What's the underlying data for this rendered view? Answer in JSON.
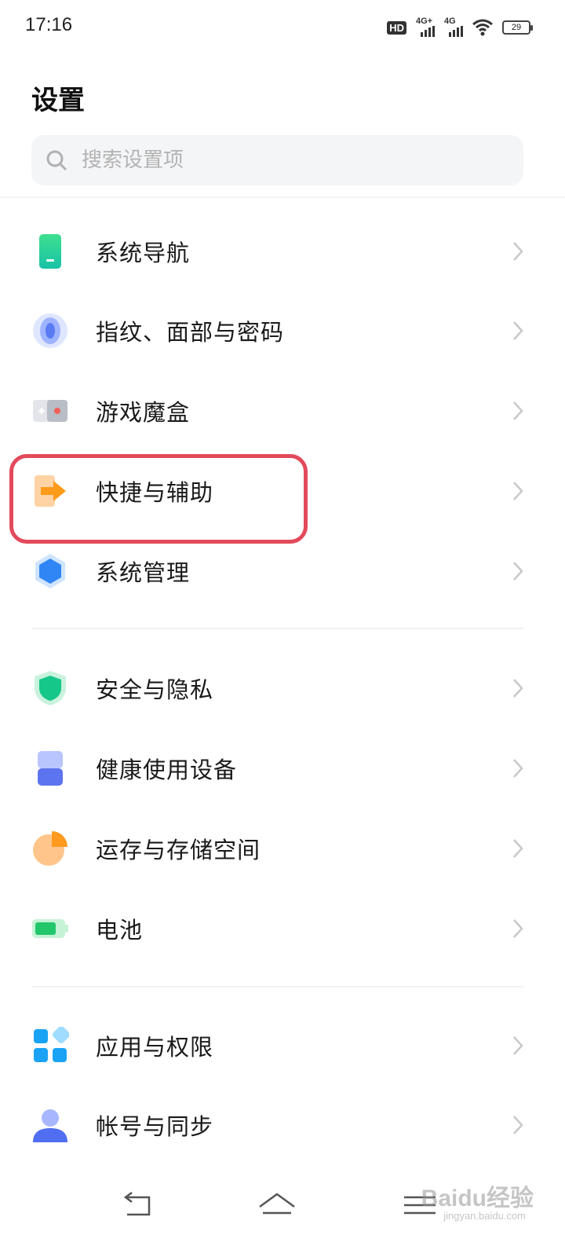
{
  "status_bar": {
    "time": "17:16",
    "hd_label": "HD",
    "network1_label": "4G+",
    "network2_label": "4G",
    "battery_level": "29"
  },
  "header": {
    "title": "设置"
  },
  "search": {
    "placeholder": "搜索设置项"
  },
  "groups": [
    {
      "items": [
        {
          "label": "系统导航",
          "icon": "phone-navigation-icon"
        },
        {
          "label": "指纹、面部与密码",
          "icon": "fingerprint-icon"
        },
        {
          "label": "游戏魔盒",
          "icon": "game-box-icon"
        },
        {
          "label": "快捷与辅助",
          "icon": "shortcut-arrow-icon",
          "highlighted": true
        },
        {
          "label": "系统管理",
          "icon": "system-hexagon-icon"
        }
      ]
    },
    {
      "items": [
        {
          "label": "安全与隐私",
          "icon": "security-shield-icon"
        },
        {
          "label": "健康使用设备",
          "icon": "hourglass-icon"
        },
        {
          "label": "运存与存储空间",
          "icon": "storage-pie-icon"
        },
        {
          "label": "电池",
          "icon": "battery-icon"
        }
      ]
    },
    {
      "items": [
        {
          "label": "应用与权限",
          "icon": "apps-grid-icon"
        },
        {
          "label": "帐号与同步",
          "icon": "account-user-icon"
        }
      ]
    }
  ],
  "watermark": {
    "text": "Baidu经验",
    "sub": "jingyan.baidu.com"
  },
  "colors": {
    "highlight_border": "#e24a5b",
    "background": "#ffffff"
  }
}
